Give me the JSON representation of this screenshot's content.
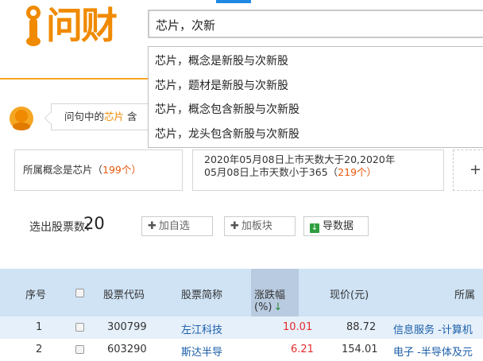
{
  "search": {
    "value": "芯片，次新"
  },
  "suggestions": [
    "芯片，概念是新股与次新股",
    "芯片，题材是新股与次新股",
    "芯片，概念包含新股与次新股",
    "芯片，龙头包含新股与次新股"
  ],
  "logo": {
    "text": "问财"
  },
  "question": {
    "prefix": "问句中的",
    "highlight": "芯片",
    "suffix": "含"
  },
  "conditions": {
    "c1_text": "所属概念是芯片（",
    "c1_count": "199",
    "c1_unit": "个）",
    "c2_line1": "2020年05月08日上市天数大于20,2020年",
    "c2_line2_text": "05月08日上市天数小于365（",
    "c2_count": "219",
    "c2_unit": "个）",
    "add": "+"
  },
  "result": {
    "label": "选出股票数：",
    "count": "20"
  },
  "toolbar": {
    "add_watch": "加自选",
    "add_board": "加板块",
    "export": "导数据"
  },
  "table": {
    "headers": {
      "index": "序号",
      "code": "股票代码",
      "name": "股票简称",
      "change": "涨跌幅(%)",
      "sort_arrow": "↓",
      "price": "现价(元)",
      "industry": "所属"
    },
    "rows": [
      {
        "index": "1",
        "code": "300799",
        "name": "左江科技",
        "change": "10.01",
        "price": "88.72",
        "industry": "信息服务 -计算机"
      },
      {
        "index": "2",
        "code": "603290",
        "name": "斯达半导",
        "change": "6.21",
        "price": "154.01",
        "industry": "电子 -半导体及元"
      }
    ]
  },
  "colors": {
    "brand_orange": "#f08a00",
    "header_blue": "#cfe3f5",
    "rise_red": "#e42b2b",
    "link_blue": "#1a5ea8"
  }
}
